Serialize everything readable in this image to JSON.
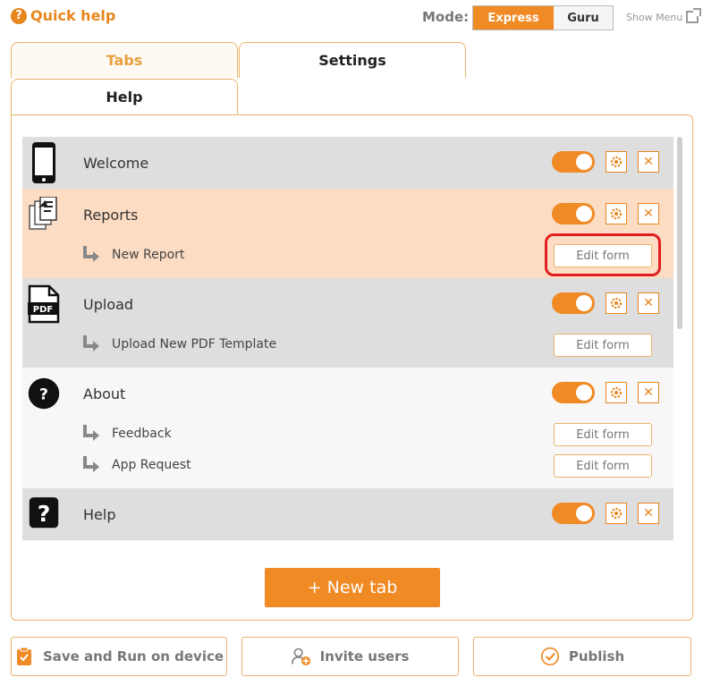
{
  "header": {
    "quick_help": "Quick help",
    "mode_label": "Mode:",
    "mode_express": "Express",
    "mode_guru": "Guru",
    "show_menu": "Show Menu"
  },
  "tabs": {
    "tabs": "Tabs",
    "settings": "Settings",
    "help": "Help"
  },
  "items": [
    {
      "label": "Welcome",
      "icon": "phone-icon",
      "enabled": true
    },
    {
      "label": "Reports",
      "icon": "reports-icon",
      "enabled": true,
      "sub": [
        "New Report"
      ]
    },
    {
      "label": "Upload",
      "icon": "pdf-icon",
      "enabled": true,
      "sub": [
        "Upload New PDF Template"
      ]
    },
    {
      "label": "About",
      "icon": "question-circle-icon",
      "enabled": true,
      "sub": [
        "Feedback",
        "App Request"
      ]
    },
    {
      "label": "Help",
      "icon": "question-bubble-icon",
      "enabled": true
    }
  ],
  "edit_form_label": "Edit form",
  "new_tab_label": "+ New tab",
  "footer": {
    "save": "Save and Run on device",
    "invite": "Invite users",
    "publish": "Publish"
  },
  "colors": {
    "accent": "#f08a24",
    "border": "#e8b46a",
    "highlight": "#e02020",
    "row_gray": "#dedede",
    "row_peach": "#fddcc4"
  }
}
